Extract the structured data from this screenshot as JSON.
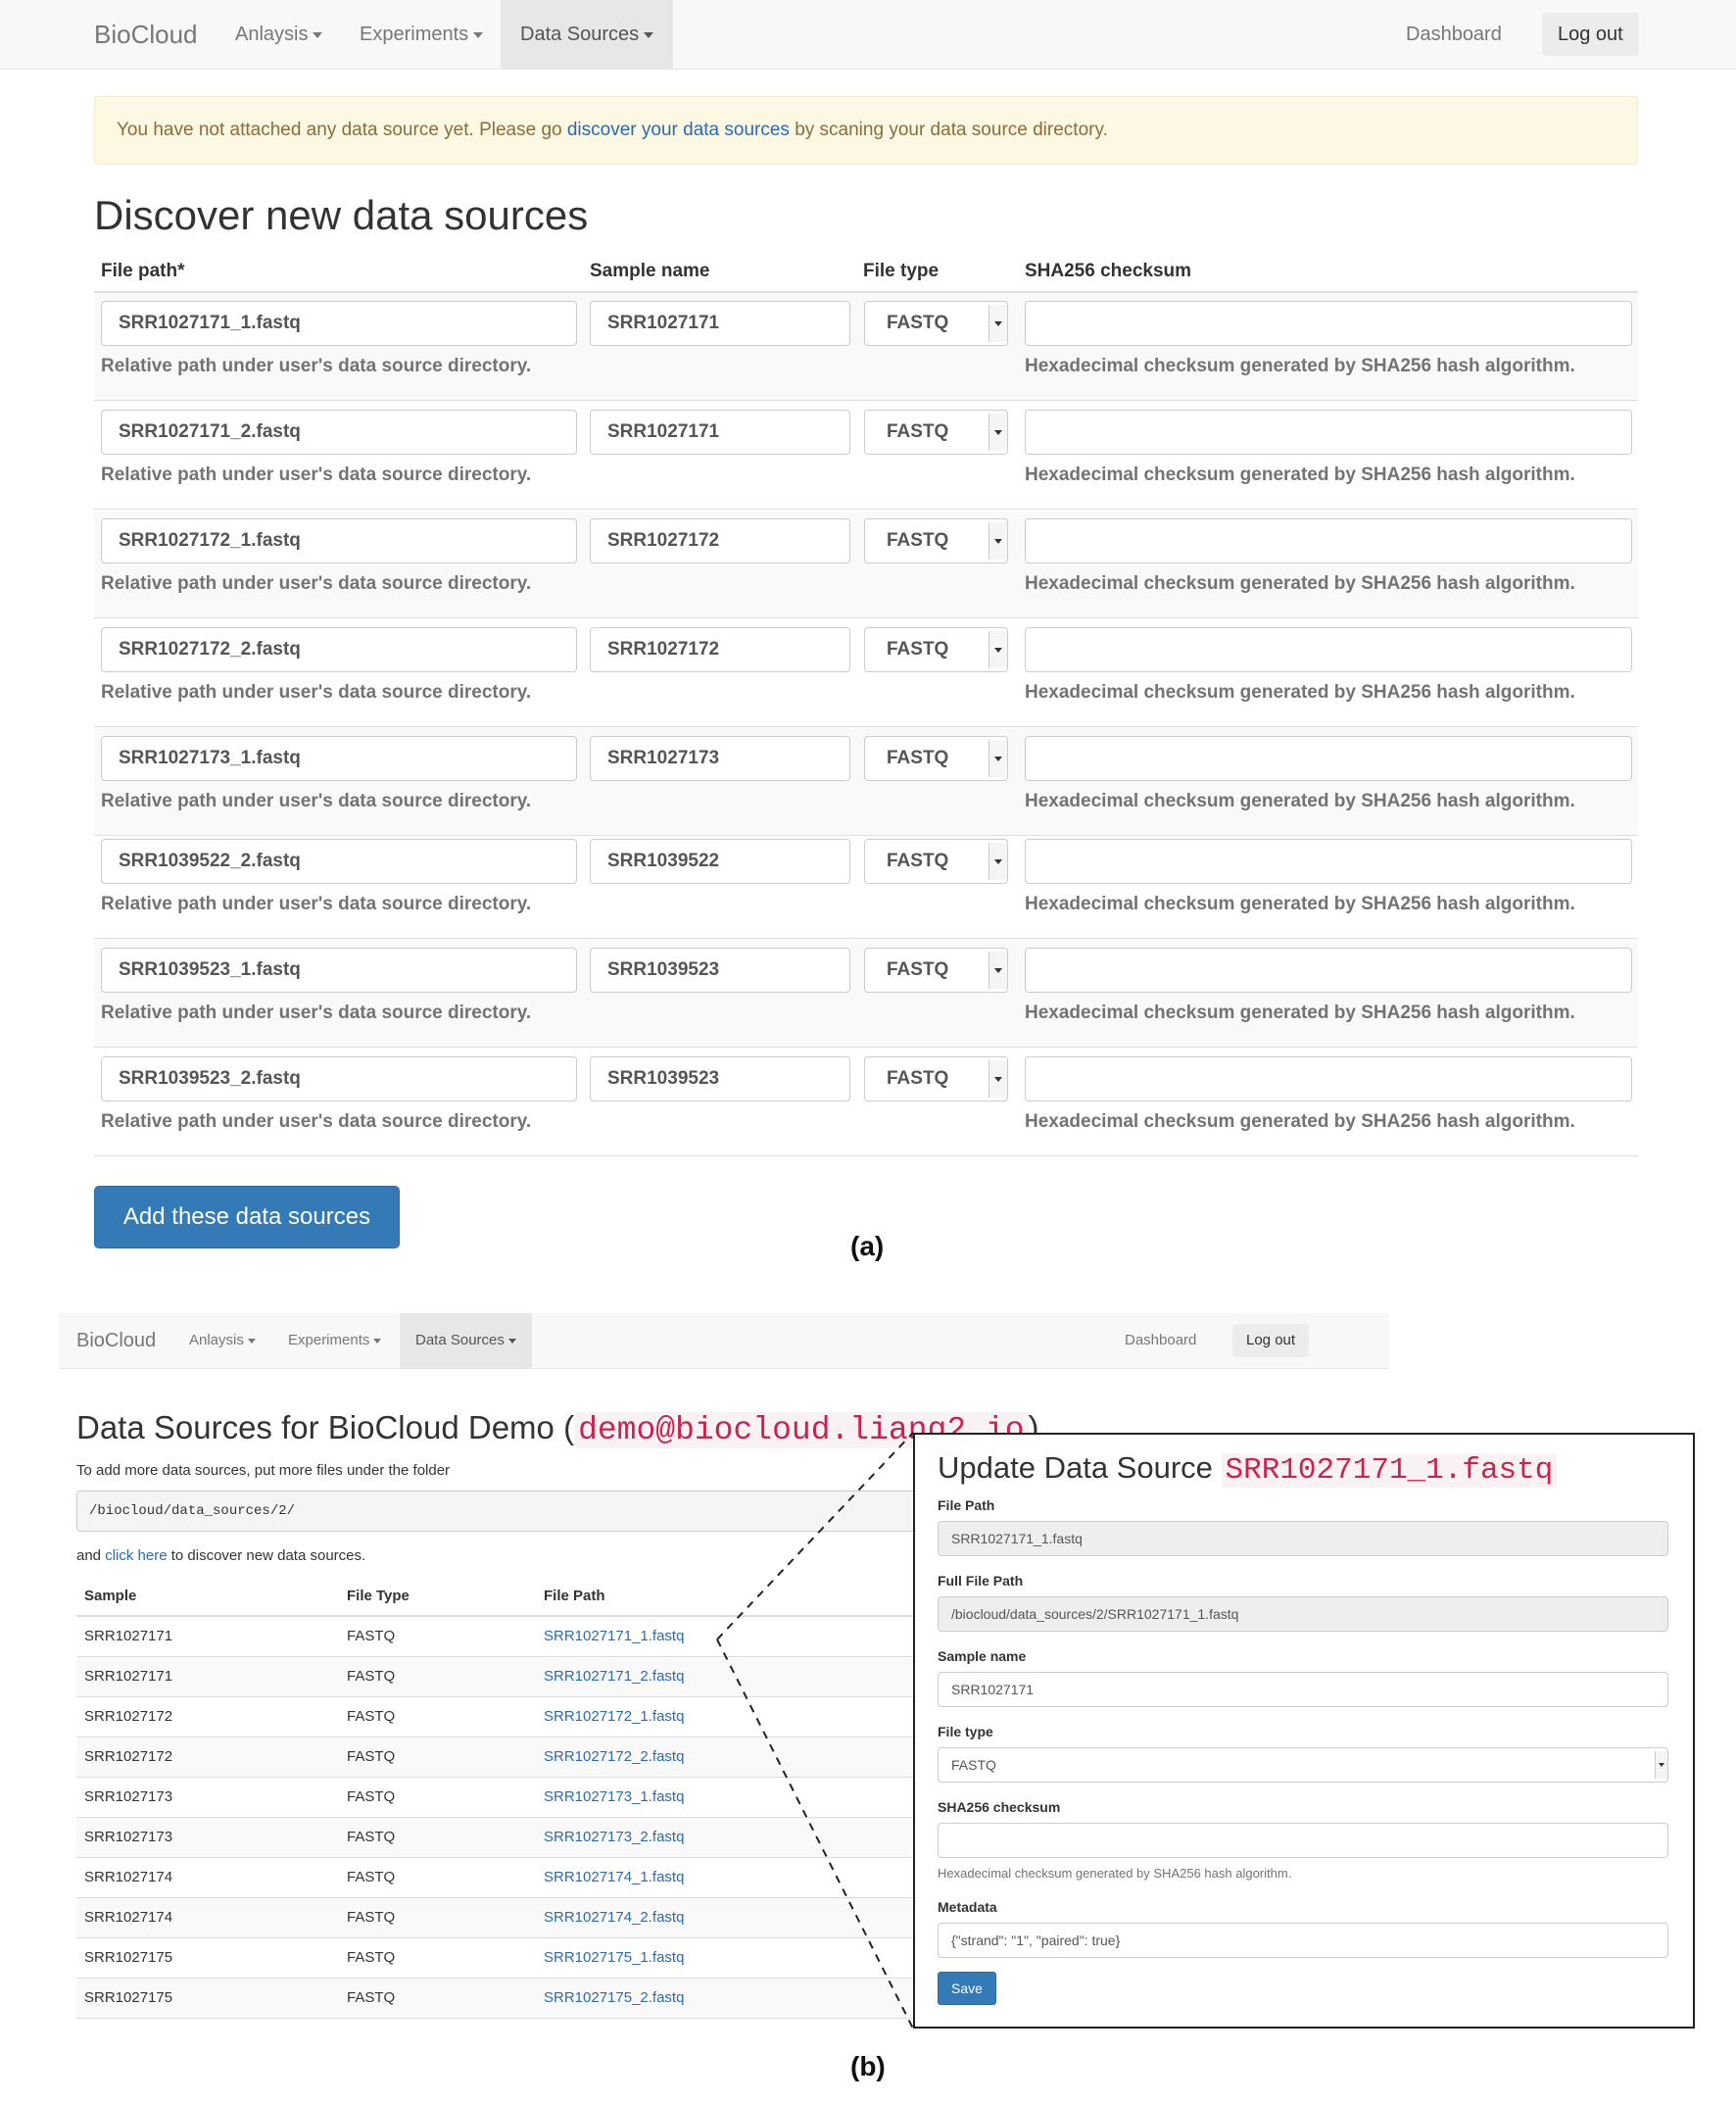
{
  "part_a": {
    "navbar": {
      "brand": "BioCloud",
      "menu": [
        "Anlaysis",
        "Experiments",
        "Data Sources"
      ],
      "dashboard": "Dashboard",
      "logout": "Log out"
    },
    "alert": {
      "before": "You have not attached any data source yet. Please go ",
      "link": "discover your data sources",
      "after": " by scaning your data source directory."
    },
    "heading": "Discover new data sources",
    "columns": [
      "File path*",
      "Sample name",
      "File type",
      "SHA256 checksum"
    ],
    "path_help": "Relative path under user's data source directory.",
    "checksum_help": "Hexadecimal checksum generated by SHA256 hash algorithm.",
    "rows": [
      {
        "path": "SRR1027171_1.fastq",
        "sample": "SRR1027171",
        "type": "FASTQ",
        "checksum": ""
      },
      {
        "path": "SRR1027171_2.fastq",
        "sample": "SRR1027171",
        "type": "FASTQ",
        "checksum": ""
      },
      {
        "path": "SRR1027172_1.fastq",
        "sample": "SRR1027172",
        "type": "FASTQ",
        "checksum": ""
      },
      {
        "path": "SRR1027172_2.fastq",
        "sample": "SRR1027172",
        "type": "FASTQ",
        "checksum": ""
      },
      {
        "path": "SRR1027173_1.fastq",
        "sample": "SRR1027173",
        "type": "FASTQ",
        "checksum": ""
      },
      {
        "path": "SRR1039522_2.fastq",
        "sample": "SRR1039522",
        "type": "FASTQ",
        "checksum": ""
      },
      {
        "path": "SRR1039523_1.fastq",
        "sample": "SRR1039523",
        "type": "FASTQ",
        "checksum": ""
      },
      {
        "path": "SRR1039523_2.fastq",
        "sample": "SRR1039523",
        "type": "FASTQ",
        "checksum": ""
      }
    ],
    "submit": "Add these data sources",
    "caption": "(a)"
  },
  "part_b": {
    "navbar": {
      "brand": "BioCloud",
      "menu": [
        "Anlaysis",
        "Experiments",
        "Data Sources"
      ],
      "dashboard": "Dashboard",
      "logout": "Log out"
    },
    "heading_prefix": "Data Sources for BioCloud Demo (",
    "heading_email": "demo@biocloud.liang2.io",
    "heading_suffix": ")",
    "intro": "To add more data sources, put more files under the folder",
    "folder": "/biocloud/data_sources/2/",
    "discover_before": "and ",
    "discover_link": "click here",
    "discover_after": " to discover new data sources.",
    "columns": [
      "Sample",
      "File Type",
      "File Path"
    ],
    "rows": [
      {
        "sample": "SRR1027171",
        "type": "FASTQ",
        "path": "SRR1027171_1.fastq"
      },
      {
        "sample": "SRR1027171",
        "type": "FASTQ",
        "path": "SRR1027171_2.fastq"
      },
      {
        "sample": "SRR1027172",
        "type": "FASTQ",
        "path": "SRR1027172_1.fastq"
      },
      {
        "sample": "SRR1027172",
        "type": "FASTQ",
        "path": "SRR1027172_2.fastq"
      },
      {
        "sample": "SRR1027173",
        "type": "FASTQ",
        "path": "SRR1027173_1.fastq"
      },
      {
        "sample": "SRR1027173",
        "type": "FASTQ",
        "path": "SRR1027173_2.fastq"
      },
      {
        "sample": "SRR1027174",
        "type": "FASTQ",
        "path": "SRR1027174_1.fastq"
      },
      {
        "sample": "SRR1027174",
        "type": "FASTQ",
        "path": "SRR1027174_2.fastq"
      },
      {
        "sample": "SRR1027175",
        "type": "FASTQ",
        "path": "SRR1027175_1.fastq"
      },
      {
        "sample": "SRR1027175",
        "type": "FASTQ",
        "path": "SRR1027175_2.fastq"
      }
    ],
    "modal": {
      "title": "Update Data Source ",
      "title_file": "SRR1027171_1.fastq",
      "file_path_label": "File Path",
      "file_path": "SRR1027171_1.fastq",
      "full_path_label": "Full File Path",
      "full_path": "/biocloud/data_sources/2/SRR1027171_1.fastq",
      "sample_label": "Sample name",
      "sample": "SRR1027171",
      "type_label": "File type",
      "type": "FASTQ",
      "checksum_label": "SHA256 checksum",
      "checksum": "",
      "checksum_help": "Hexadecimal checksum generated by SHA256 hash algorithm.",
      "metadata_label": "Metadata",
      "metadata": "{\"strand\": \"1\", \"paired\": true}",
      "save": "Save"
    },
    "caption": "(b)"
  },
  "colors": {
    "primary": "#337ab7",
    "link": "#2a6bb0",
    "code": "#c7254e",
    "alert_bg": "#fcf8e3",
    "alert_text": "#8a6d3b"
  }
}
